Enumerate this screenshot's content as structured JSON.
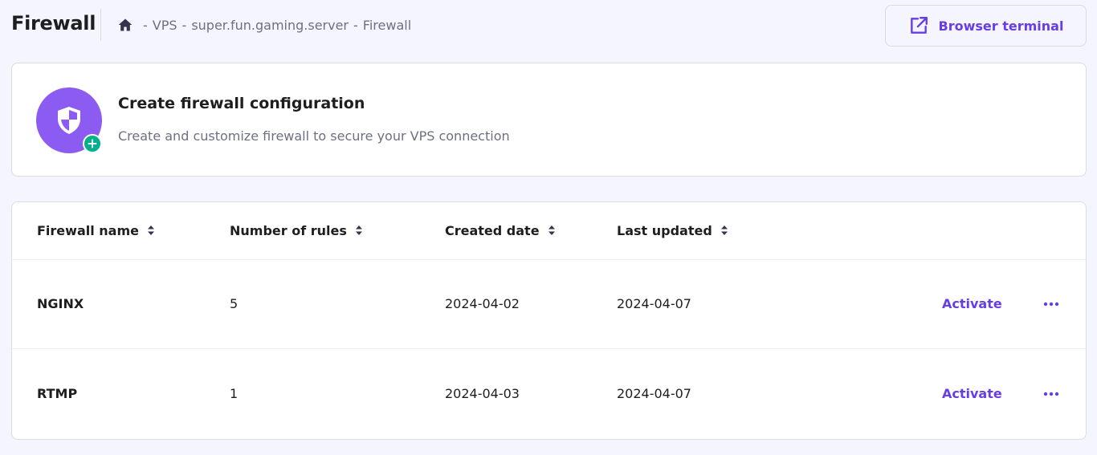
{
  "header": {
    "title": "Firewall",
    "breadcrumb": [
      "VPS",
      "super.fun.gaming.server",
      "Firewall"
    ],
    "breadcrumb_separator": "-",
    "terminal_button": "Browser terminal"
  },
  "create_card": {
    "title": "Create firewall configuration",
    "subtitle": "Create and customize firewall to secure your VPS connection"
  },
  "table": {
    "columns": [
      "Firewall name",
      "Number of rules",
      "Created date",
      "Last updated"
    ],
    "rows": [
      {
        "name": "NGINX",
        "rules": "5",
        "created": "2024-04-02",
        "updated": "2024-04-07",
        "action": "Activate"
      },
      {
        "name": "RTMP",
        "rules": "1",
        "created": "2024-04-03",
        "updated": "2024-04-07",
        "action": "Activate"
      }
    ]
  },
  "colors": {
    "accent": "#673de6",
    "shield_bg": "#8c5cf2",
    "badge": "#00b090",
    "page_bg": "#f4f5ff"
  },
  "icons": [
    "home-icon",
    "external-link-icon",
    "shield-icon",
    "plus-icon",
    "sort-icon",
    "more-icon"
  ]
}
